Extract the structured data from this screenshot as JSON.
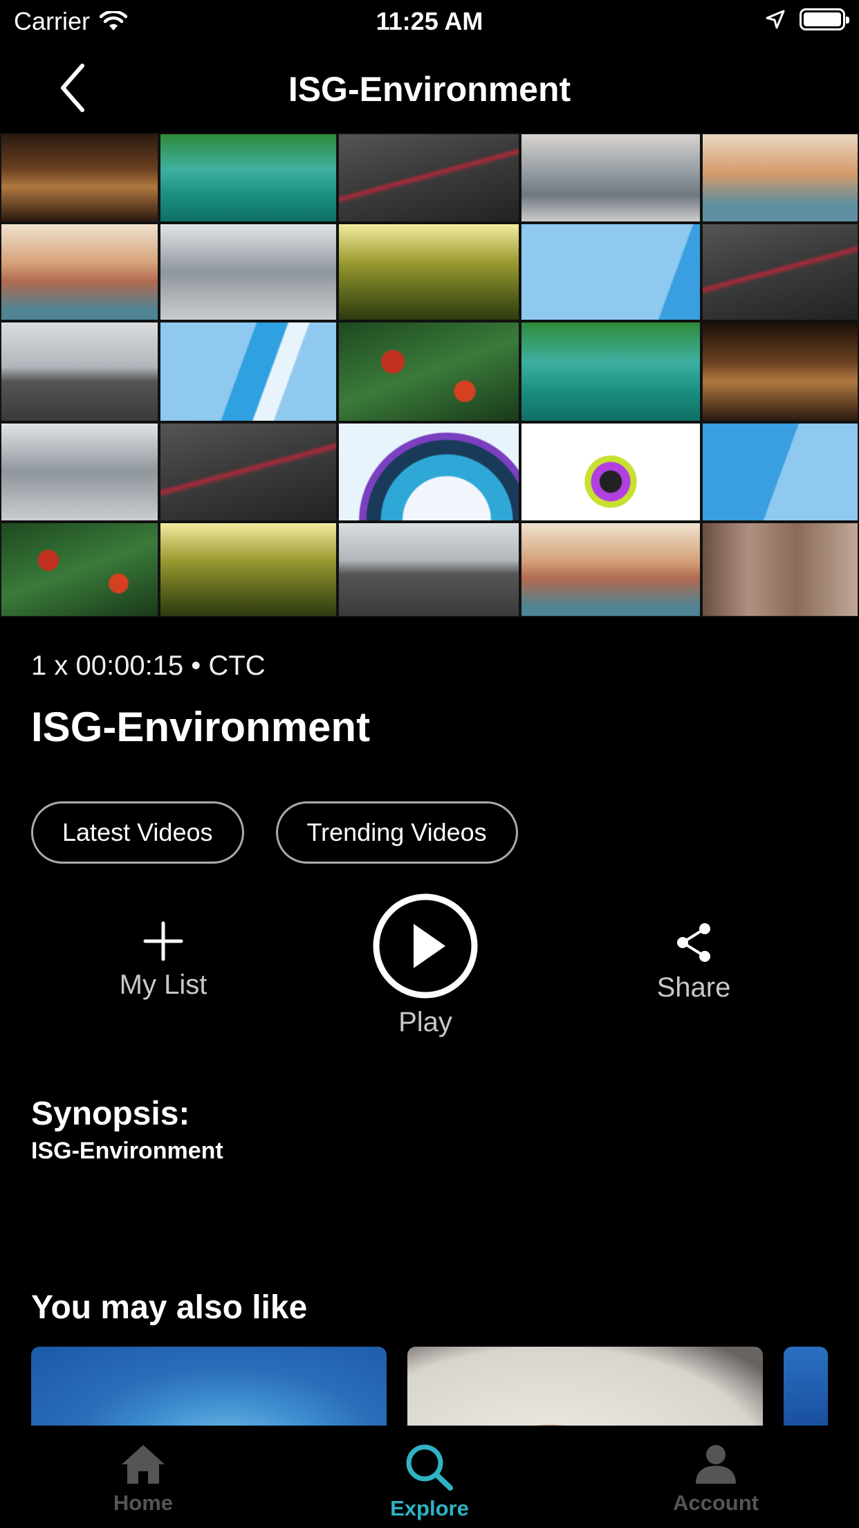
{
  "status_bar": {
    "carrier": "Carrier",
    "time": "11:25 AM"
  },
  "nav": {
    "title": "ISG-Environment",
    "back_icon": "chevron-left-icon"
  },
  "hero": {
    "tiles": [
      "city-night-tower",
      "underwater-swimmer",
      "building-facade",
      "snowy-mountains",
      "coastal-town",
      "coastal-town",
      "snowy-mountains",
      "forest-sunrise",
      "blue-abstract",
      "building-facade",
      "motorcycle-road",
      "blue-abstract",
      "red-flowers",
      "underwater-swimmer",
      "city-night-tower",
      "snowy-mountains",
      "building-facade",
      "isg-logo",
      "skull-logo",
      "blue-abstract",
      "red-flowers",
      "forest-sunrise",
      "motorcycle-road",
      "coastal-town",
      "city-skyline"
    ]
  },
  "content": {
    "meta": "1 x 00:00:15  • CTC",
    "title": "ISG-Environment",
    "chips": [
      "Latest Videos",
      "Trending Videos"
    ]
  },
  "actions": {
    "my_list": "My List",
    "play": "Play",
    "share": "Share"
  },
  "synopsis": {
    "label": "Synopsis:",
    "text": "ISG-Environment"
  },
  "recommendations": {
    "heading": "You may also like"
  },
  "tab_bar": {
    "items": [
      {
        "label": "Home",
        "icon": "home-icon"
      },
      {
        "label": "Explore",
        "icon": "search-icon"
      },
      {
        "label": "Account",
        "icon": "account-icon"
      }
    ],
    "active": "Explore",
    "active_color": "#2fb3c4"
  }
}
